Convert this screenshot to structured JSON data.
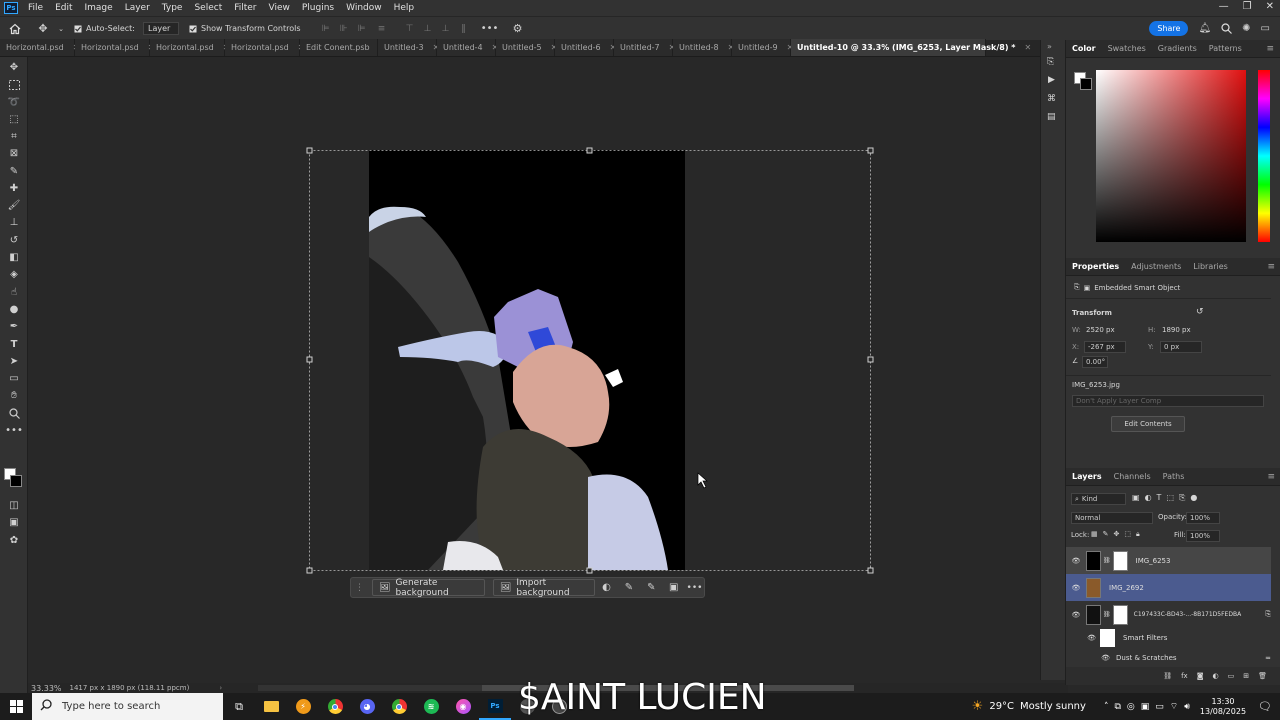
{
  "menubar": {
    "items": [
      "File",
      "Edit",
      "Image",
      "Layer",
      "Type",
      "Select",
      "Filter",
      "View",
      "Plugins",
      "Window",
      "Help"
    ]
  },
  "optionsbar": {
    "auto_select_label": "Auto-Select:",
    "auto_select_value": "Layer",
    "transform_controls_label": "Show Transform Controls",
    "share_label": "Share"
  },
  "tabs": [
    {
      "label": "Horizontal.psd"
    },
    {
      "label": "Horizontal.psd"
    },
    {
      "label": "Horizontal.psd"
    },
    {
      "label": "Horizontal.psd"
    },
    {
      "label": "Edit Conent.psb"
    },
    {
      "label": "Untitled-3"
    },
    {
      "label": "Untitled-4"
    },
    {
      "label": "Untitled-5"
    },
    {
      "label": "Untitled-6"
    },
    {
      "label": "Untitled-7"
    },
    {
      "label": "Untitled-8"
    },
    {
      "label": "Untitled-9"
    },
    {
      "label": "Untitled-10 @ 33.3% (IMG_6253, Layer Mask/8) *"
    }
  ],
  "context_bar": {
    "generate_label": "Generate background",
    "import_label": "Import background"
  },
  "color_panel": {
    "tabs": [
      "Color",
      "Swatches",
      "Gradients",
      "Patterns"
    ]
  },
  "properties_panel": {
    "tabs": [
      "Properties",
      "Adjustments",
      "Libraries"
    ],
    "object_type": "Embedded Smart Object",
    "transform_label": "Transform",
    "w_label": "W:",
    "w_value": "2520 px",
    "h_label": "H:",
    "h_value": "1890 px",
    "x_label": "X:",
    "x_value": "-267 px",
    "y_label": "Y:",
    "y_value": "0 px",
    "angle_value": "0.00°",
    "filename": "IMG_6253.jpg",
    "layer_comp_placeholder": "Don't Apply Layer Comp",
    "edit_contents_label": "Edit Contents"
  },
  "layers_panel": {
    "tabs": [
      "Layers",
      "Channels",
      "Paths"
    ],
    "kind_label": "Kind",
    "blend_mode": "Normal",
    "opacity_label": "Opacity:",
    "opacity_value": "100%",
    "lock_label": "Lock:",
    "fill_label": "Fill:",
    "fill_value": "100%",
    "layers": [
      {
        "name": "IMG_6253"
      },
      {
        "name": "IMG_2692"
      },
      {
        "name": "C197433C-BD43-...-8B171D5FEDBA"
      },
      {
        "name": "Smart Filters"
      },
      {
        "name": "Dust & Scratches"
      }
    ]
  },
  "statusbar": {
    "zoom": "33.33%",
    "doc_info": "1417 px x 1890 px (118.11 ppcm)"
  },
  "overlay_text": "$AINT LUCIEN",
  "taskbar": {
    "search_placeholder": "Type here to search",
    "weather_temp": "29°C",
    "weather_desc": "Mostly sunny",
    "time": "13:30",
    "date": "13/08/2025"
  },
  "colors": {
    "accent": "#31a8ff",
    "selected_layer": "#4b5b8f",
    "share_button": "#1473e6"
  }
}
